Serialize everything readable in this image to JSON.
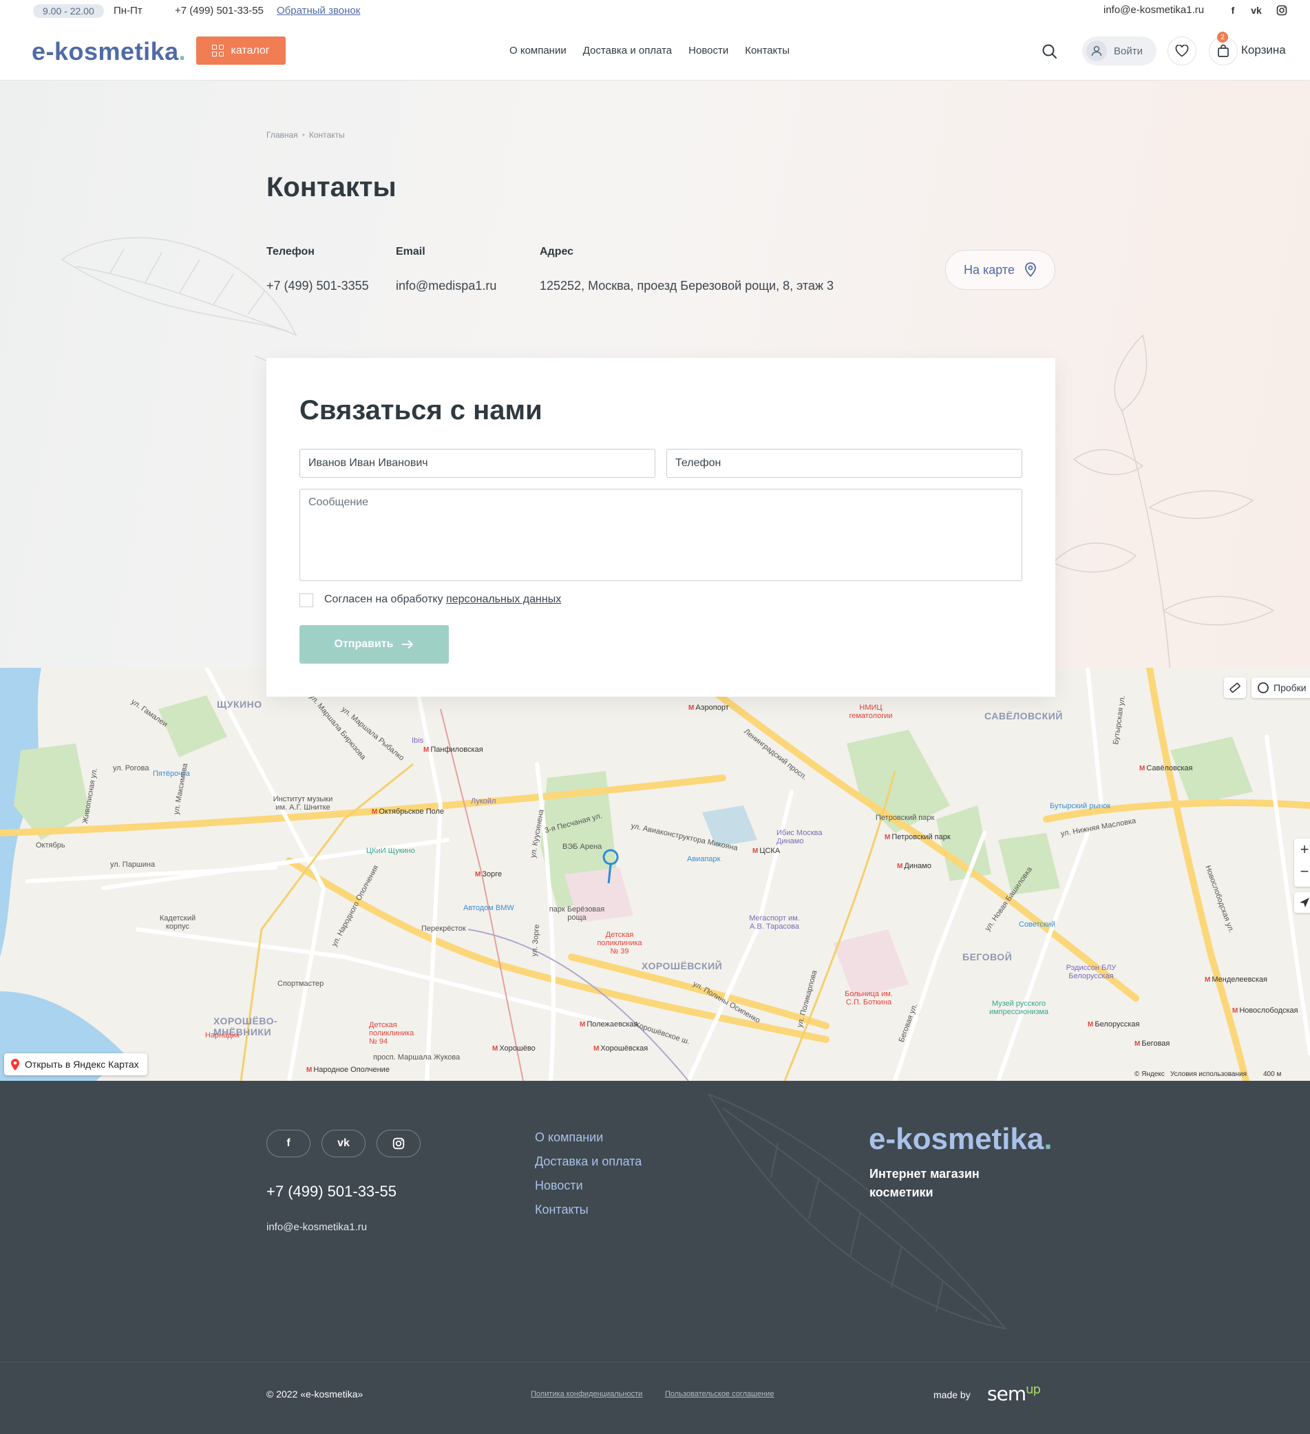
{
  "topbar": {
    "hours": "9.00 - 22.00",
    "days": "Пн-Пт",
    "phone": "+7 (499) 501-33-55",
    "callback": "Обратный звонок",
    "email": "info@e-kosmetika1.ru",
    "social_icons": [
      "facebook-icon",
      "vk-icon",
      "instagram-icon"
    ]
  },
  "header": {
    "logo": "e-kosmetika",
    "catalog": "каталог",
    "nav": [
      "О компании",
      "Доставка и оплата",
      "Новости",
      "Контакты"
    ],
    "login": "Войти",
    "cart_count": "2",
    "cart_label": "Корзина"
  },
  "breadcrumbs": [
    "Главная",
    "Контакты"
  ],
  "page_title": "Контакты",
  "contacts": {
    "phone_label": "Телефон",
    "phone": "+7 (499) 501-3355",
    "email_label": "Email",
    "email": "info@medispa1.ru",
    "address_label": "Адрес",
    "address": "125252, Москва, проезд Березовой рощи, 8, этаж 3",
    "map_button": "На карте"
  },
  "form": {
    "title": "Связаться с нами",
    "name_value": "Иванов Иван Иванович",
    "phone_placeholder": "Телефон",
    "message_placeholder": "Сообщение",
    "agree_text": "Согласен на обработку ",
    "agree_link": "персональных данных",
    "submit": "Отправить"
  },
  "map": {
    "open_link": "Открыть в Яндекс Картах",
    "traffic": "Пробки",
    "copyright": "© Яндекс",
    "terms": "Условия использования",
    "scale": "400 м",
    "districts": [
      "ЩУКИНО",
      "САВЁЛОВСКИЙ",
      "ХОРОШЁВСКИЙ",
      "БЕГОВОЙ",
      "ХОРОШЁВО-МНЁВНИКИ"
    ],
    "metro": [
      "Панфиловская",
      "Октябрьское Поле",
      "Зорге",
      "ЦСКА",
      "Динамо",
      "Петровский парк",
      "Савёловская",
      "Белорусская",
      "Беговая",
      "Полежаевская",
      "Хорошёво",
      "Хорошёвская",
      "Аэропорт",
      "Менделеевская",
      "Новослободская",
      "Народное Ополчение"
    ],
    "places": [
      "Пятёрочка",
      "Ibis",
      "Лукойл",
      "ВЭБ Арена",
      "Авиапарк",
      "Ибис Москва Динамо",
      "Автодом BMW",
      "парк Берёзовая роща",
      "Детская поликлиника № 39",
      "Мегаспорт им. А.В. Тарасова",
      "Перекрёсток",
      "Спортмастер",
      "Кадетский корпус",
      "ЦКиИ Щукино",
      "Институт музыки им. А.Г. Шнитке",
      "Октябрь",
      "Петровский парк",
      "Советский",
      "Рэдиссон БЛУ Белорусская",
      "Музей русского импрессионизма",
      "Больница им. С.П. Боткина",
      "НМИЦ гематологии",
      "Бутырский рынок",
      "Нарнадик",
      "Детская поликлиника № 94"
    ],
    "streets": [
      "ул. Гамалеи",
      "ул. Рогова",
      "ул. Паршина",
      "Живописная ул.",
      "ул. Максимова",
      "ул. Маршала Бирюзова",
      "ул. Маршала Рыбалко",
      "ул. Народного Ополчения",
      "3-я Песчаная ул.",
      "ул. Авиаконструктора Микояна",
      "Ленинградский просп.",
      "Хорошёвское ш.",
      "ул. Поликарпова",
      "ул. Нижняя Масловка",
      "Бутырская ул.",
      "Новослободская ул.",
      "ул. Новая Башиловка",
      "просп. Маршала Жукова",
      "ул. Зорге",
      "ул. Куусинена",
      "ул. Полины Осипенко",
      "Беговая ул."
    ]
  },
  "footer": {
    "phone": "+7 (499) 501-33-55",
    "email": "info@e-kosmetika1.ru",
    "nav": [
      "О компании",
      "Доставка и оплата",
      "Новости",
      "Контакты"
    ],
    "logo": "e-kosmetika",
    "tagline": "Интернет магазин косметики",
    "copyright": "© 2022 «e-kosmetika»",
    "privacy": "Политика конфиденциальности",
    "agreement": "Пользовательское соглашение",
    "made_by": "made by",
    "dev_logo": "sem",
    "dev_logo_suffix": "up"
  },
  "colors": {
    "brand": "#4f6aa6",
    "accent": "#f07d53",
    "mint": "#9fd0c6",
    "footer_bg": "#404850"
  }
}
